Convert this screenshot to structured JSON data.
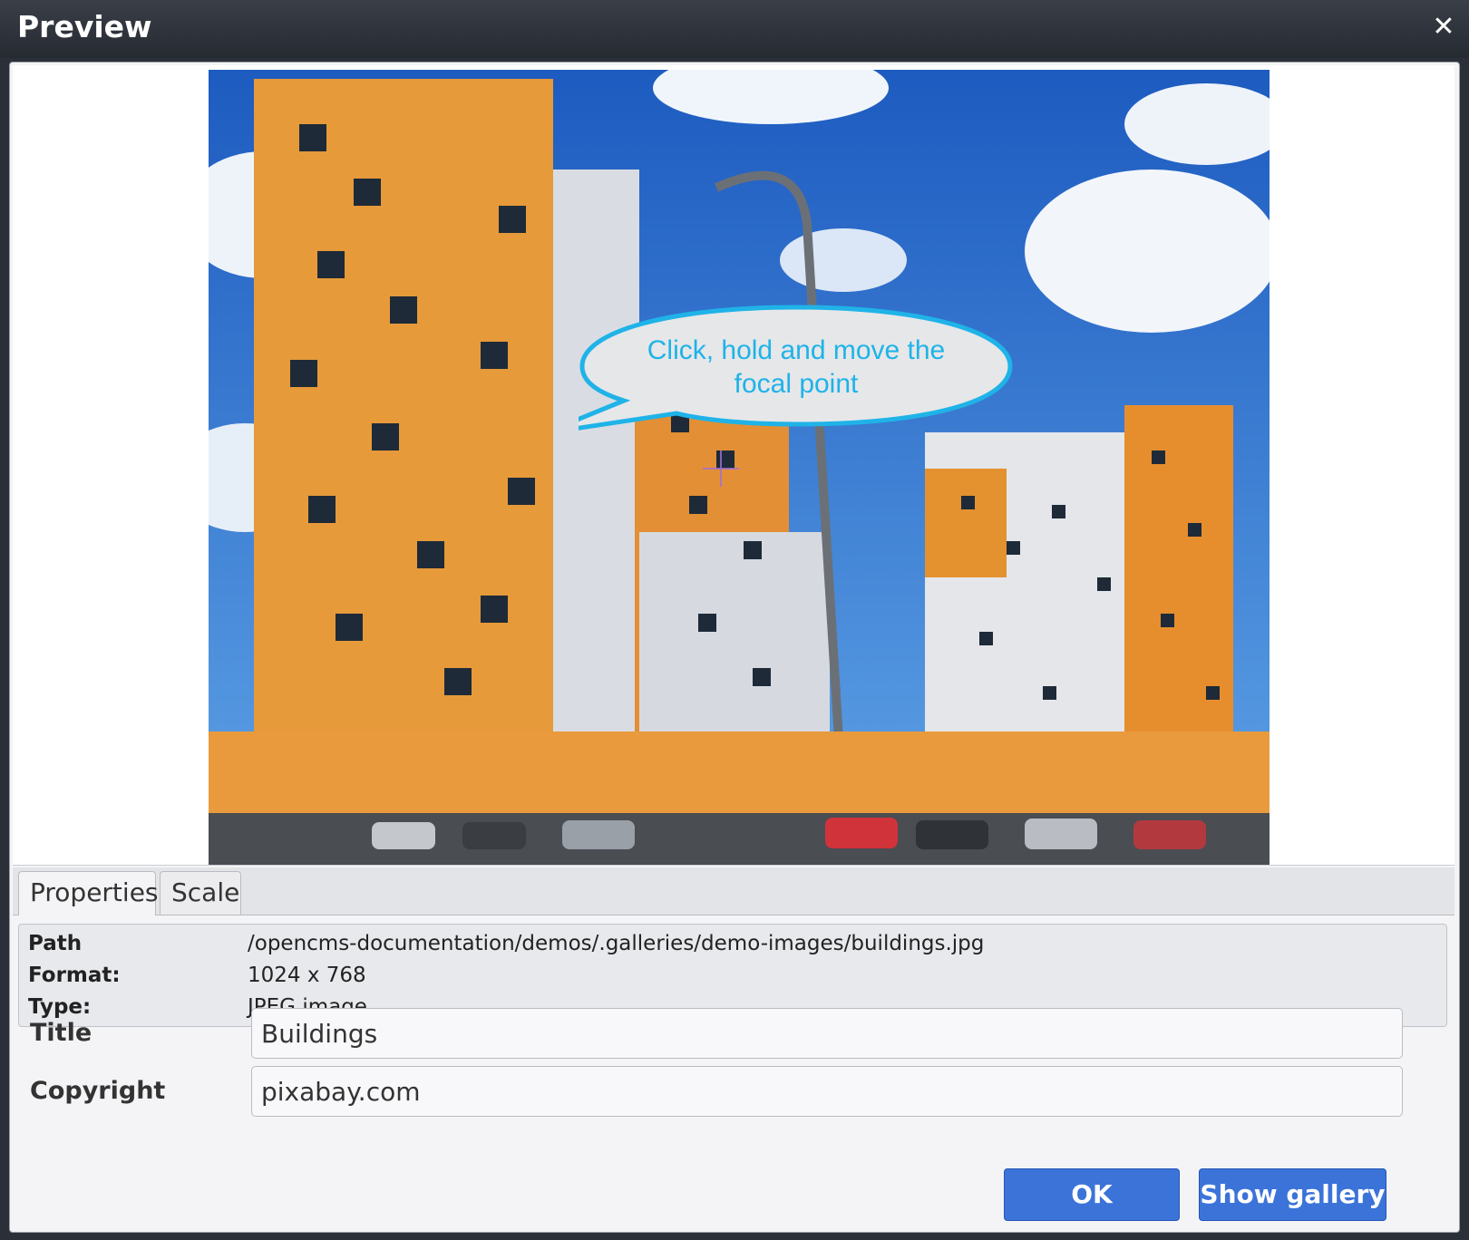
{
  "window": {
    "title": "Preview",
    "close_icon": "close-icon"
  },
  "preview": {
    "image_alt": "buildings",
    "tooltip": "Click, hold and move the focal point"
  },
  "tabs": [
    {
      "label": "Properties",
      "active": true
    },
    {
      "label": "Scale",
      "active": false
    }
  ],
  "info": {
    "path_label": "Path",
    "path_value": "/opencms-documentation/demos/.galleries/demo-images/buildings.jpg",
    "format_label": "Format:",
    "format_value": "1024 x 768",
    "type_label": "Type:",
    "type_value": "JPEG image"
  },
  "fields": {
    "title_label": "Title",
    "title_value": "Buildings",
    "copyright_label": "Copyright",
    "copyright_value": "pixabay.com"
  },
  "buttons": {
    "ok": "OK",
    "show_gallery": "Show gallery"
  },
  "colors": {
    "accent": "#3b73d9",
    "tooltip_text": "#1fb3e8",
    "titlebar": "#2b3038"
  }
}
